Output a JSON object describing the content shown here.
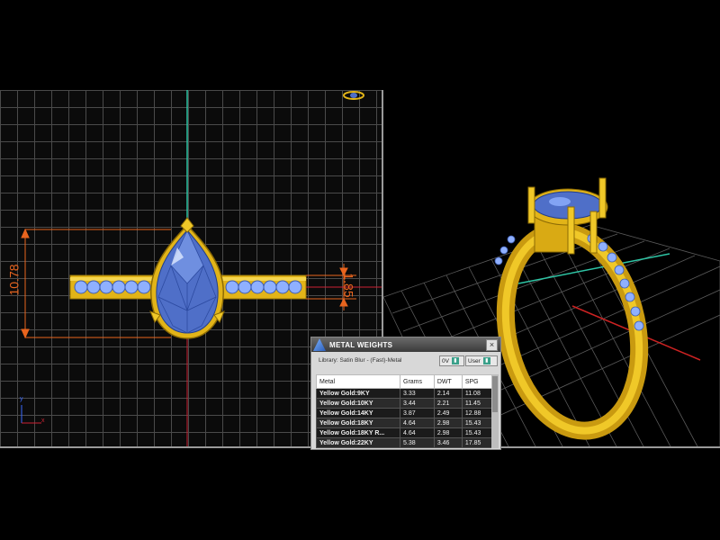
{
  "dimensions": {
    "height": "10.78",
    "band_width": "1.85"
  },
  "metal_panel": {
    "title": "METAL WEIGHTS",
    "library": "Library: Satin Blur - (Fast)-Metal",
    "control_a": "0V",
    "control_b": "User",
    "close_label": "×",
    "columns": [
      "Metal",
      "Grams",
      "DWT",
      "SPG"
    ],
    "rows": [
      [
        "Yellow Gold:9KY",
        "3.33",
        "2.14",
        "11.08"
      ],
      [
        "Yellow Gold:10KY",
        "3.44",
        "2.21",
        "11.45"
      ],
      [
        "Yellow Gold:14KY",
        "3.87",
        "2.49",
        "12.88"
      ],
      [
        "Yellow Gold:18KY",
        "4.64",
        "2.98",
        "15.43"
      ],
      [
        "Yellow Gold:18KY R...",
        "4.64",
        "2.98",
        "15.43"
      ],
      [
        "Yellow Gold:22KY",
        "5.38",
        "3.46",
        "17.85"
      ]
    ]
  },
  "axes": {
    "y": "y",
    "x": "x"
  },
  "colors": {
    "gold": "#e2b418",
    "stone": "#4f6fc8",
    "dimension": "#e8641e",
    "grid": "#4a4a4a"
  },
  "icons": [
    "app-icon",
    "close-icon",
    "ring-preview-icon",
    "axis-gizmo-icon"
  ]
}
